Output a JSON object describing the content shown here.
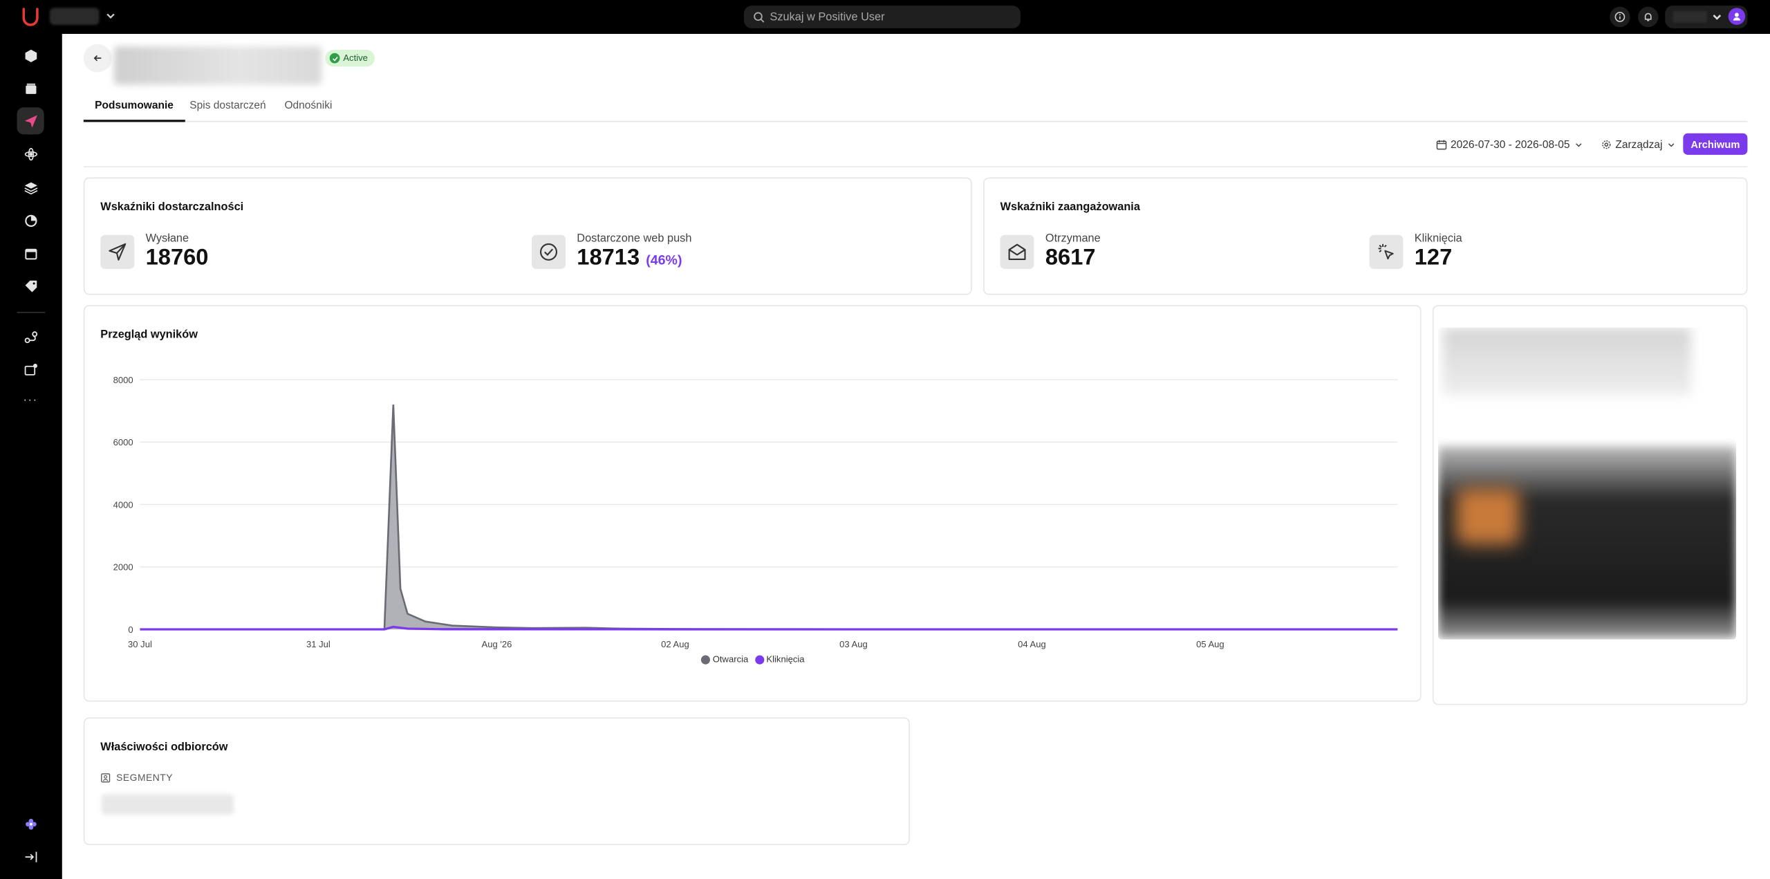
{
  "topbar": {
    "search_placeholder": "Szukaj w Positive User"
  },
  "campaign": {
    "status": "Active"
  },
  "tabs": [
    {
      "label": "Podsumowanie",
      "active": true
    },
    {
      "label": "Spis dostarczeń",
      "active": false
    },
    {
      "label": "Odnośniki",
      "active": false
    }
  ],
  "toolbar": {
    "date_range": "2026-07-30 - 2026-08-05",
    "manage_label": "Zarządzaj",
    "archive_label": "Archiwum"
  },
  "deliverability": {
    "title": "Wskaźniki dostarczalności",
    "sent_label": "Wysłane",
    "sent_value": "18760",
    "delivered_label": "Dostarczone web push",
    "delivered_value": "18713",
    "delivered_pct": "(46%)"
  },
  "engagement": {
    "title": "Wskaźniki zaangażowania",
    "received_label": "Otrzymane",
    "received_value": "8617",
    "clicks_label": "Kliknięcia",
    "clicks_value": "127"
  },
  "results": {
    "title": "Przegląd wyników"
  },
  "recipients": {
    "title": "Właściwości odbiorców",
    "segments_label": "SEGMENTY"
  },
  "colors": {
    "accent": "#7c3aed",
    "opens_series": "#6b6b73",
    "clicks_series": "#7c3aed",
    "active_badge_bg": "#d9f5d6"
  },
  "chart_data": {
    "type": "area",
    "x_ticks": [
      "30 Jul",
      "31 Jul",
      "Aug '26",
      "02 Aug",
      "03 Aug",
      "04 Aug",
      "05 Aug"
    ],
    "y_ticks": [
      "0",
      "2000",
      "4000",
      "6000",
      "8000"
    ],
    "ylim": [
      0,
      8000
    ],
    "xlim": [
      0,
      7.05
    ],
    "grid": true,
    "legend_position": "bottom-center",
    "series": [
      {
        "name": "Otwarcia",
        "color": "#6b6b73",
        "x": [
          0,
          1,
          1.37,
          1.42,
          1.46,
          1.5,
          1.6,
          1.75,
          2.0,
          2.2,
          2.5,
          2.7,
          3,
          4,
          5,
          6,
          7.05
        ],
        "values": [
          0,
          0,
          0,
          7200,
          1300,
          500,
          250,
          120,
          60,
          40,
          50,
          20,
          10,
          5,
          3,
          2,
          0
        ]
      },
      {
        "name": "Kliknięcia",
        "color": "#7c3aed",
        "x": [
          0,
          1,
          1.37,
          1.42,
          1.5,
          1.7,
          2,
          3,
          4,
          5,
          6,
          7.05
        ],
        "values": [
          0,
          0,
          0,
          80,
          20,
          5,
          2,
          0,
          0,
          0,
          0,
          0
        ]
      }
    ]
  }
}
